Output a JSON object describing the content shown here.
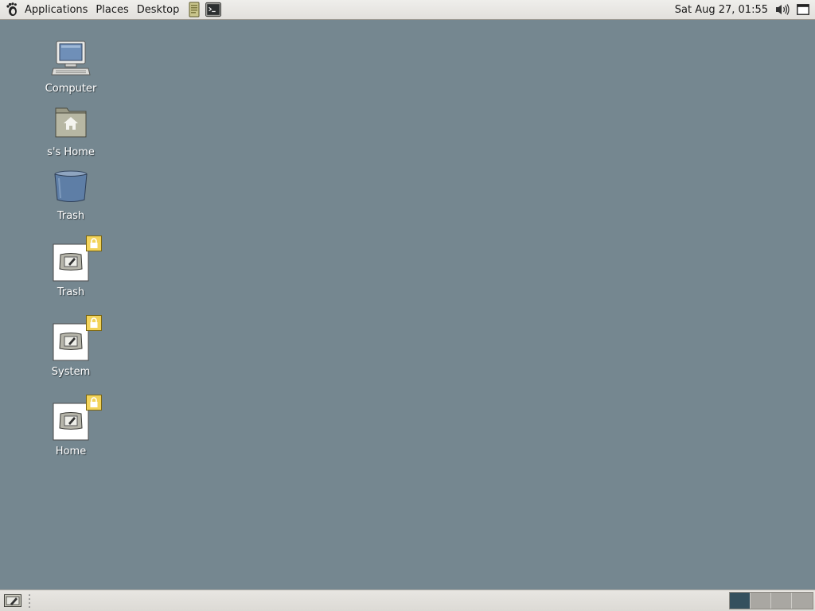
{
  "top_panel": {
    "menus": {
      "applications": "Applications",
      "places": "Places",
      "desktop": "Desktop"
    },
    "clock": "Sat Aug 27, 01:55"
  },
  "desktop_icons": [
    {
      "label": "Computer",
      "icon": "computer-icon"
    },
    {
      "label": "s's Home",
      "icon": "home-folder-icon"
    },
    {
      "label": "Trash",
      "icon": "trash-icon"
    },
    {
      "label": "Trash",
      "icon": "locked-launcher-icon"
    },
    {
      "label": "System",
      "icon": "locked-launcher-icon"
    },
    {
      "label": "Home",
      "icon": "locked-launcher-icon"
    }
  ],
  "bottom_panel": {
    "workspaces": 4,
    "active_workspace": 1
  },
  "colors": {
    "desktop_background": "#758790",
    "panel": "#e6e4e0",
    "active_workspace": "#34505e",
    "lock_badge": "#f2d35a"
  }
}
